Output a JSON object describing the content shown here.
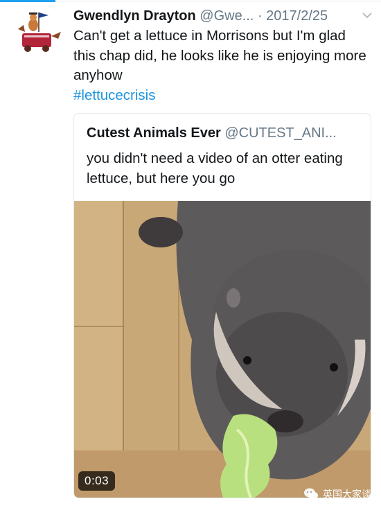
{
  "tweet": {
    "author_name": "Gwendlyn Drayton",
    "author_handle": "@Gwe...",
    "separator": "·",
    "date": "2017/2/25",
    "text": "Can't get a lettuce in Morrisons but I'm glad this chap did, he looks like he is enjoying more anyhow",
    "hashtag": "#lettucecrisis"
  },
  "quoted": {
    "author_name": "Cutest Animals Ever",
    "author_handle": "@CUTEST_ANI...",
    "text": "you didn't need a video of an otter eating lettuce, but here you go",
    "video_duration": "0:03"
  },
  "watermark": {
    "text": "英国大家谈"
  },
  "icons": {
    "menu": "chevron-down-icon",
    "avatar": "avatar",
    "watermark": "wechat-icon"
  },
  "colors": {
    "link": "#1b95e0",
    "accent": "#1da1f2",
    "muted": "#657786"
  }
}
